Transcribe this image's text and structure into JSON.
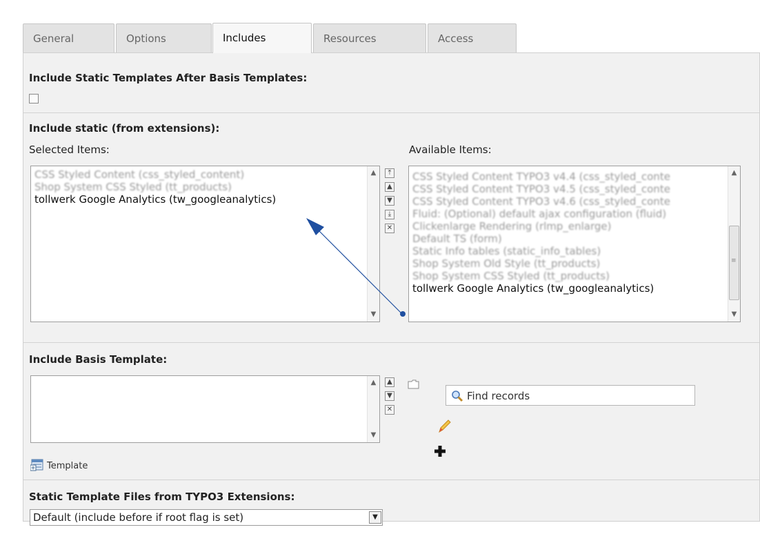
{
  "tabs": [
    {
      "label": "General",
      "active": false
    },
    {
      "label": "Options",
      "active": false
    },
    {
      "label": "Includes",
      "active": true
    },
    {
      "label": "Resources",
      "active": false
    },
    {
      "label": "Access",
      "active": false
    }
  ],
  "include_after_basis": {
    "label": "Include Static Templates After Basis Templates:",
    "checked": false
  },
  "include_static": {
    "label": "Include static (from extensions):",
    "selected_label": "Selected Items:",
    "available_label": "Available Items:",
    "selected_items": [
      {
        "text": "CSS Styled Content (css_styled_content)",
        "blurred": true
      },
      {
        "text": "Shop System CSS Styled (tt_products)",
        "blurred": true
      },
      {
        "text": "tollwerk Google Analytics (tw_googleanalytics)",
        "blurred": false
      }
    ],
    "available_items": [
      {
        "text": "CSS Styled Content TYPO3 v4.4 (css_styled_conte",
        "blurred": true
      },
      {
        "text": "CSS Styled Content TYPO3 v4.5 (css_styled_conte",
        "blurred": true
      },
      {
        "text": "CSS Styled Content TYPO3 v4.6 (css_styled_conte",
        "blurred": true
      },
      {
        "text": "Fluid: (Optional) default ajax configuration (fluid)",
        "blurred": true
      },
      {
        "text": "Clickenlarge Rendering (rlmp_enlarge)",
        "blurred": true
      },
      {
        "text": "Default TS (form)",
        "blurred": true
      },
      {
        "text": "Static Info tables (static_info_tables)",
        "blurred": true
      },
      {
        "text": "Shop System Old Style (tt_products)",
        "blurred": true
      },
      {
        "text": "Shop System CSS Styled (tt_products)",
        "blurred": true
      },
      {
        "text": "tollwerk Google Analytics (tw_googleanalytics)",
        "blurred": false
      }
    ],
    "annotation_color": "#1f4fa0"
  },
  "basis_template": {
    "label": "Include Basis Template:",
    "find_placeholder": "Find records",
    "template_link": "Template"
  },
  "static_files": {
    "label": "Static Template Files from TYPO3 Extensions:",
    "value": "Default (include before if root flag is set)"
  }
}
